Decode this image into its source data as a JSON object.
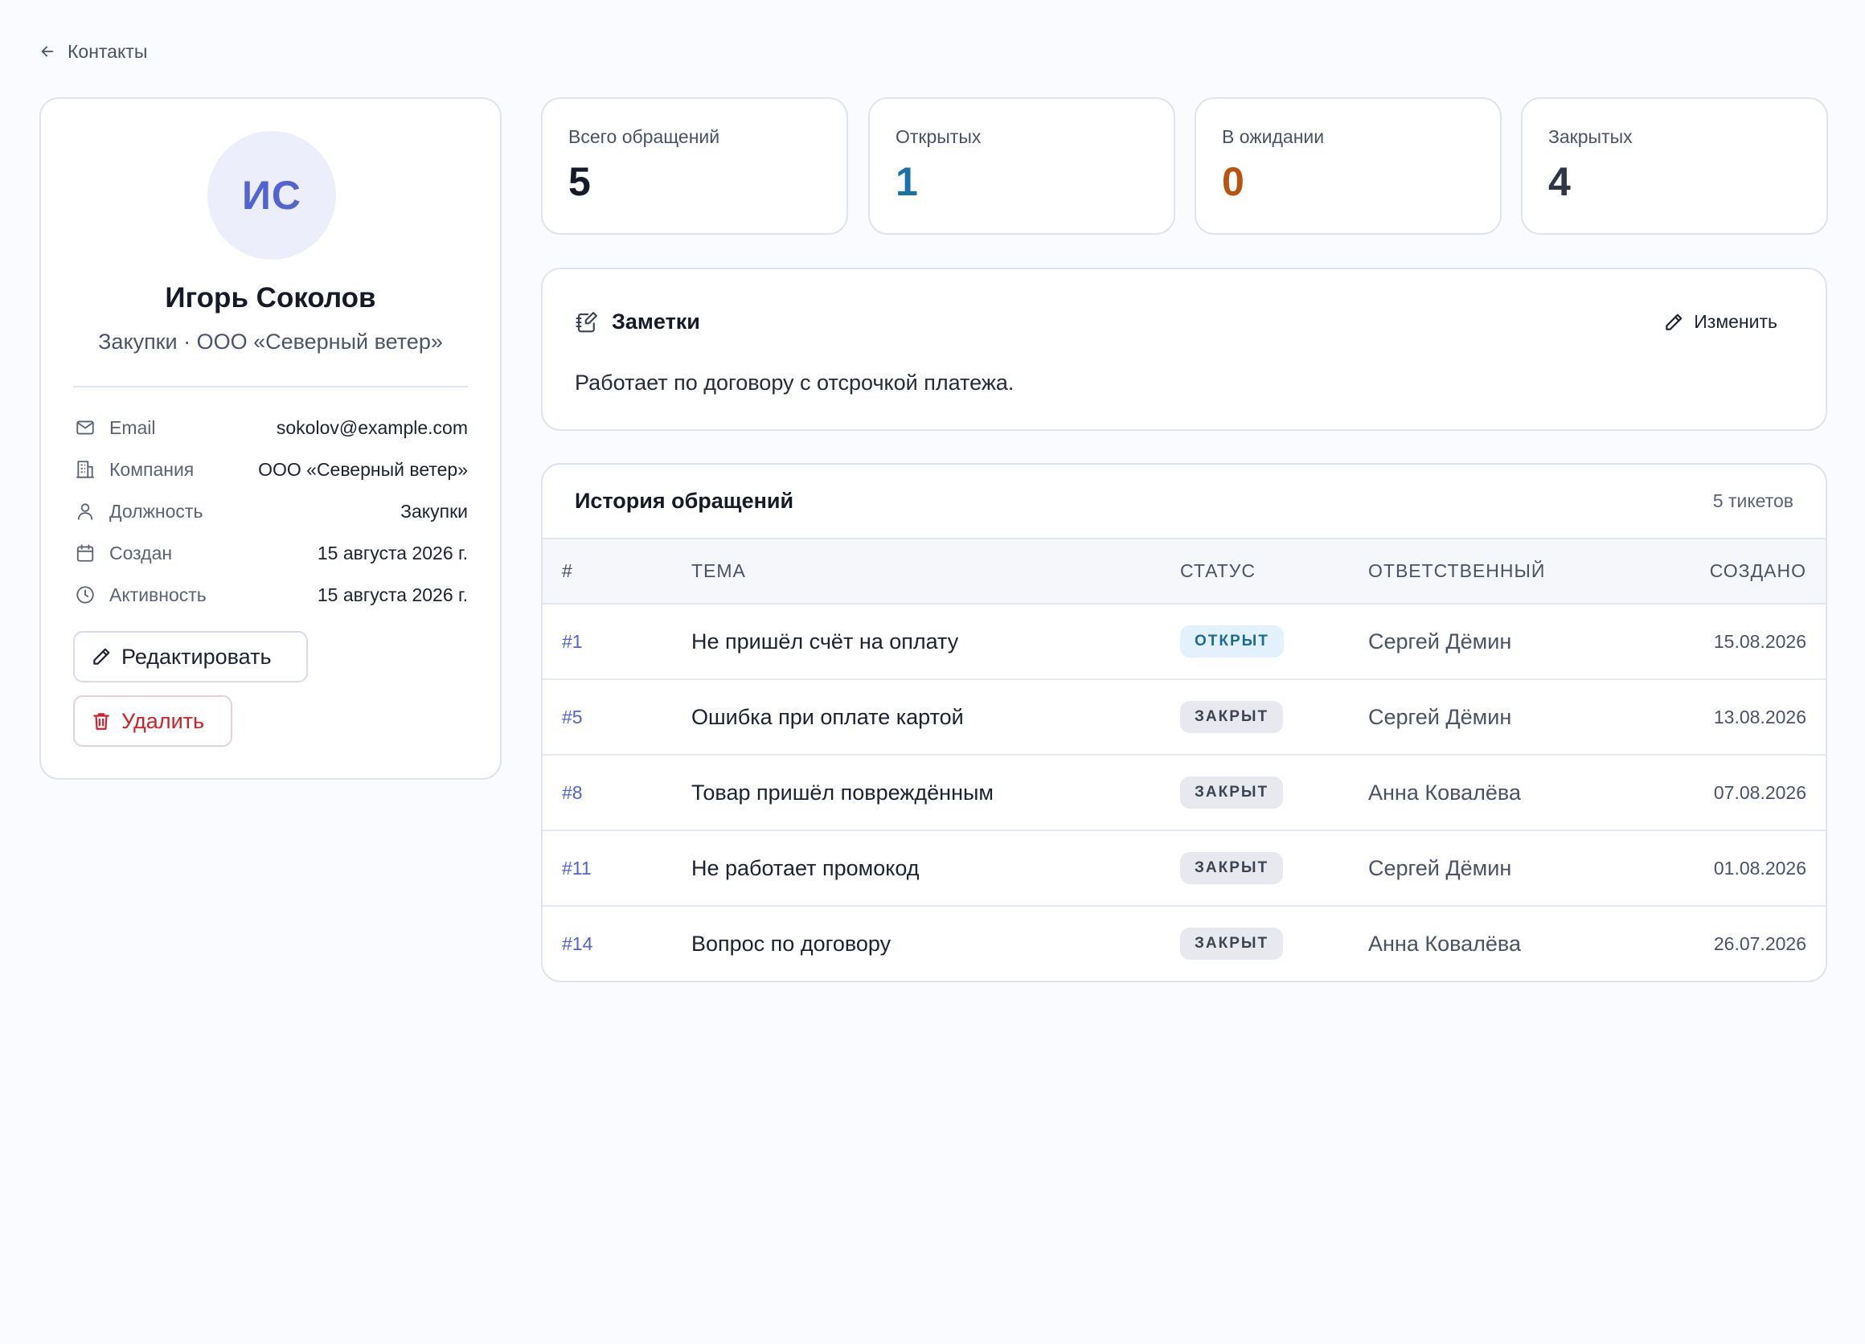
{
  "back": {
    "label": "Контакты"
  },
  "profile": {
    "initials": "ИС",
    "name": "Игорь Соколов",
    "subtitle": "Закупки · ООО «Северный ветер»",
    "fields": [
      {
        "label": "Email",
        "value": "sokolov@example.com",
        "icon": "mail-icon"
      },
      {
        "label": "Компания",
        "value": "ООО «Северный ветер»",
        "icon": "building-icon"
      },
      {
        "label": "Должность",
        "value": "Закупки",
        "icon": "user-icon"
      },
      {
        "label": "Создан",
        "value": "15 августа 2026 г.",
        "icon": "calendar-icon"
      },
      {
        "label": "Активность",
        "value": "15 августа 2026 г.",
        "icon": "clock-icon"
      }
    ],
    "edit_label": "Редактировать",
    "delete_label": "Удалить"
  },
  "stats": [
    {
      "label": "Всего обращений",
      "value": "5",
      "color": "#151a26"
    },
    {
      "label": "Открытых",
      "value": "1",
      "color": "#1b72a8"
    },
    {
      "label": "В ожидании",
      "value": "0",
      "color": "#b9530e"
    },
    {
      "label": "Закрытых",
      "value": "4",
      "color": "#2f3747"
    }
  ],
  "notes": {
    "title": "Заметки",
    "edit_label": "Изменить",
    "text": "Работает по договору с отсрочкой платежа."
  },
  "history": {
    "title": "История обращений",
    "count": "5 тикетов",
    "columns": [
      "#",
      "ТЕМА",
      "СТАТУС",
      "ОТВЕТСТВЕННЫЙ",
      "СОЗДАНО"
    ],
    "rows": [
      {
        "id": "#1",
        "topic": "Не пришёл счёт на оплату",
        "status": "ОТКРЫТ",
        "status_kind": "open",
        "owner": "Сергей Дёмин",
        "date": "15.08.2026"
      },
      {
        "id": "#5",
        "topic": "Ошибка при оплате картой",
        "status": "ЗАКРЫТ",
        "status_kind": "closed",
        "owner": "Сергей Дёмин",
        "date": "13.08.2026"
      },
      {
        "id": "#8",
        "topic": "Товар пришёл повреждённым",
        "status": "ЗАКРЫТ",
        "status_kind": "closed",
        "owner": "Анна Ковалёва",
        "date": "07.08.2026"
      },
      {
        "id": "#11",
        "topic": "Не работает промокод",
        "status": "ЗАКРЫТ",
        "status_kind": "closed",
        "owner": "Сергей Дёмин",
        "date": "01.08.2026"
      },
      {
        "id": "#14",
        "topic": "Вопрос по договору",
        "status": "ЗАКРЫТ",
        "status_kind": "closed",
        "owner": "Анна Ковалёва",
        "date": "26.07.2026"
      }
    ]
  }
}
